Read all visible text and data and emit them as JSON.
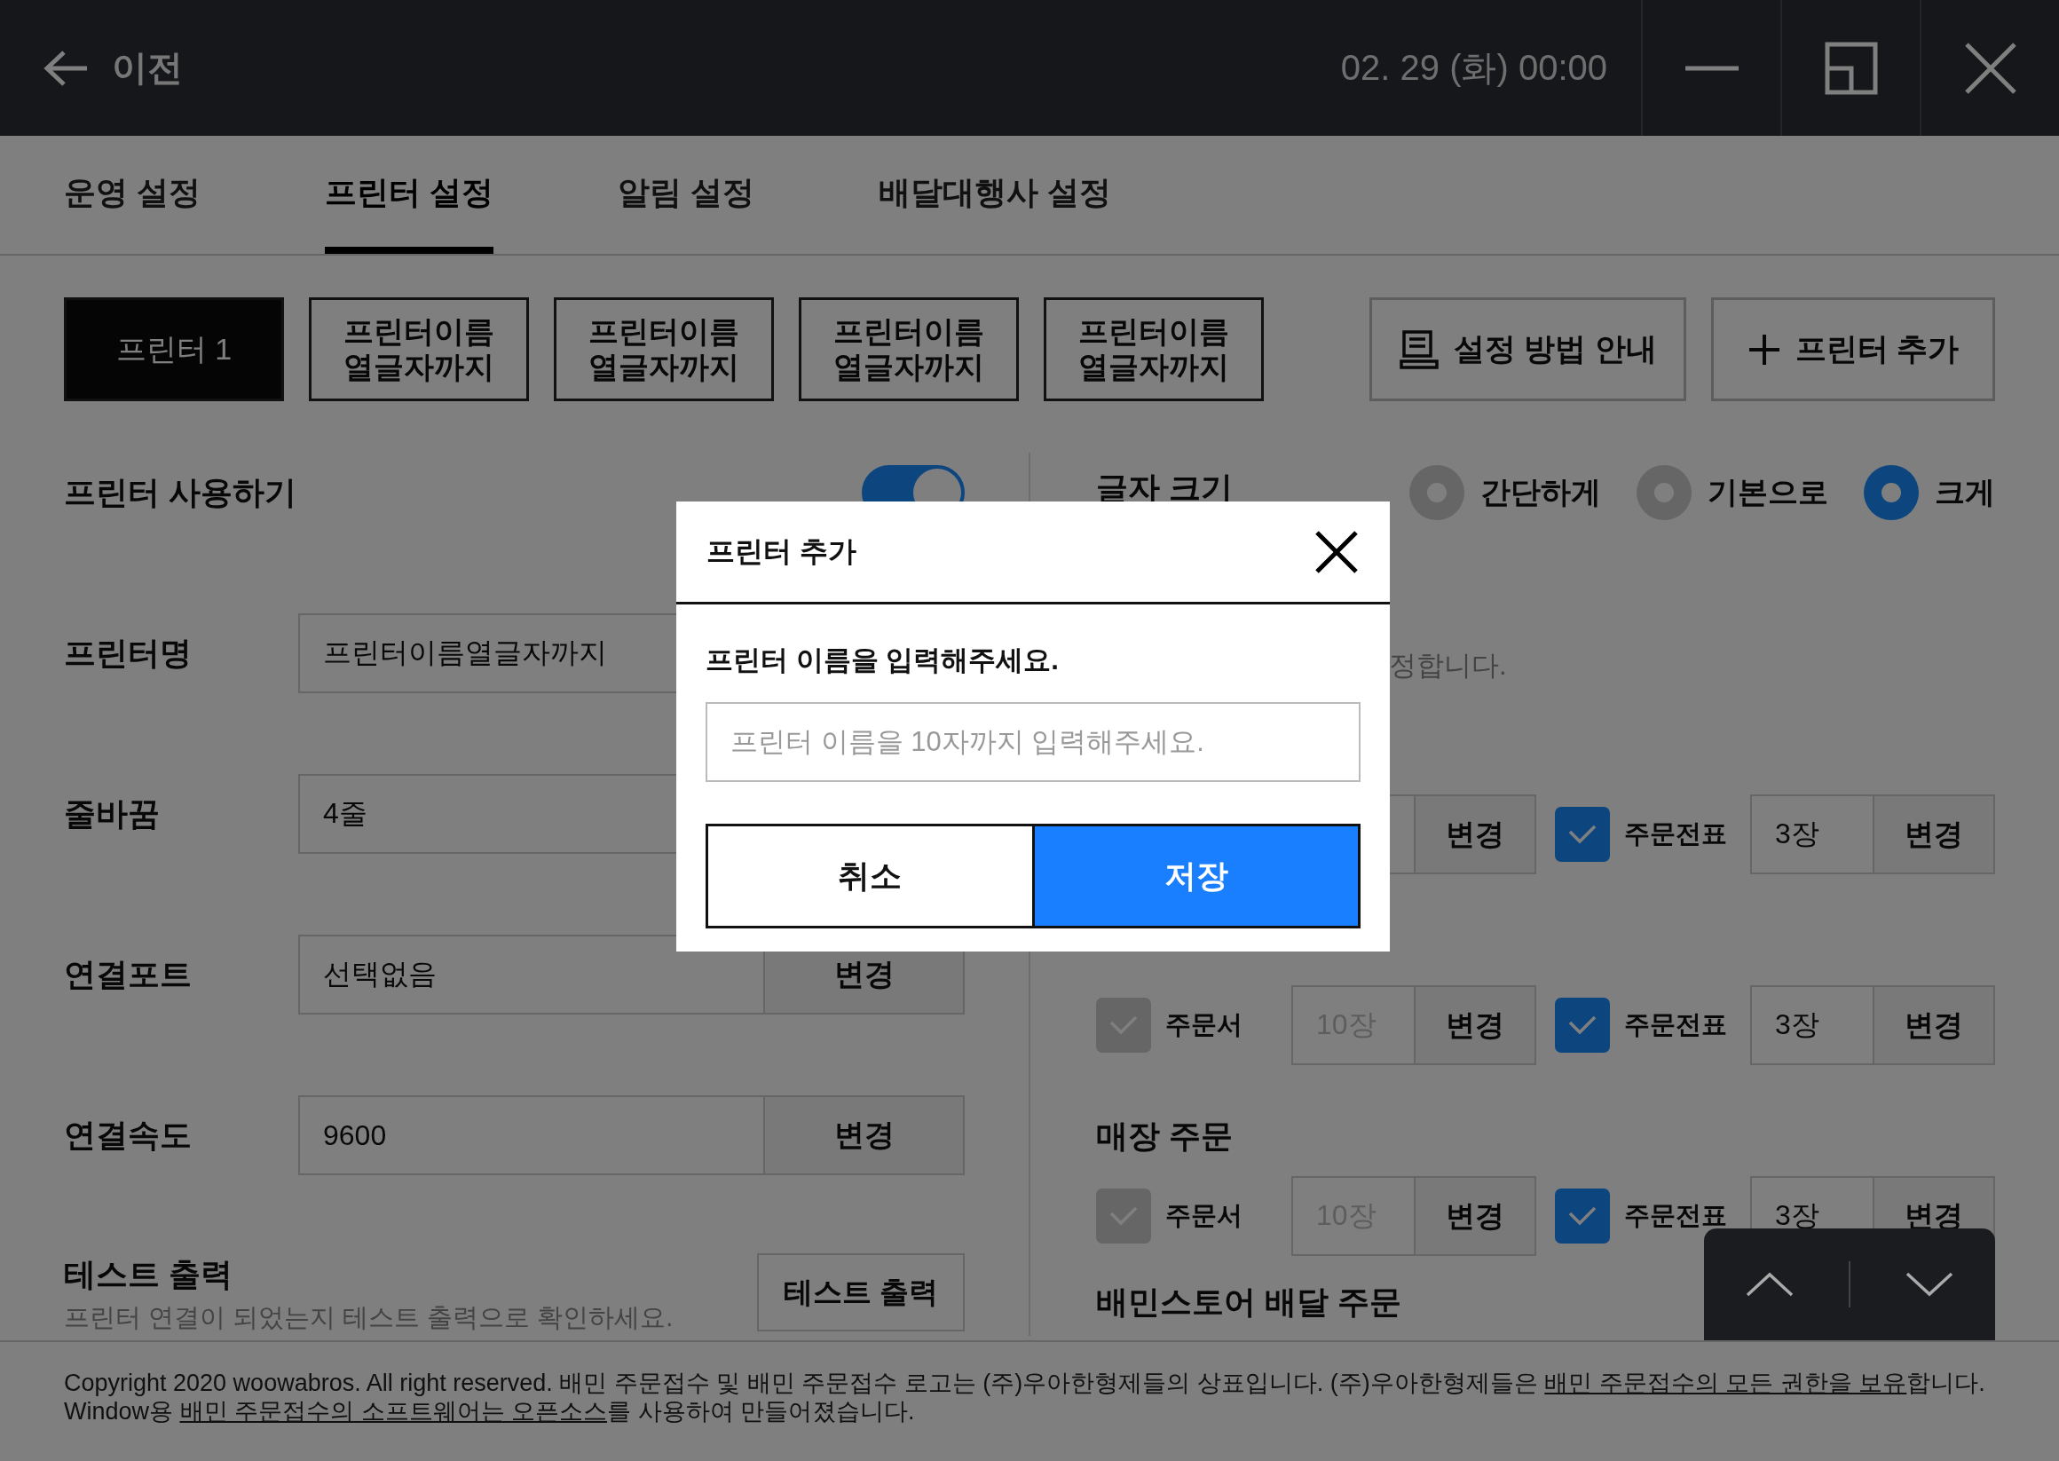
{
  "topbar": {
    "back_label": "이전",
    "datetime": "02. 29 (화) 00:00"
  },
  "tabs": [
    {
      "label": "운영 설정",
      "selected": false
    },
    {
      "label": "프린터 설정",
      "selected": true
    },
    {
      "label": "알림 설정",
      "selected": false
    },
    {
      "label": "배달대행사 설정",
      "selected": false
    }
  ],
  "printers": [
    {
      "label": "프린터 1",
      "selected": true
    },
    {
      "label": "프린터이름\n열글자까지",
      "selected": false
    },
    {
      "label": "프린터이름\n열글자까지",
      "selected": false
    },
    {
      "label": "프린터이름\n열글자까지",
      "selected": false
    },
    {
      "label": "프린터이름\n열글자까지",
      "selected": false
    }
  ],
  "actions": [
    {
      "kind": "guide",
      "label": "설정 방법 안내"
    },
    {
      "kind": "add",
      "label": "프린터 추가"
    }
  ],
  "use_printer": {
    "label": "프린터 사용하기",
    "on": true
  },
  "fields": [
    {
      "label": "프린터명",
      "value": "프린터이름열글자까지"
    },
    {
      "label": "줄바꿈",
      "value": "4줄"
    },
    {
      "label": "연결포트",
      "value": "선택없음",
      "button": "변경"
    },
    {
      "label": "연결속도",
      "value": "9600",
      "button": "변경"
    }
  ],
  "test_print": {
    "title": "테스트 출력",
    "description": "프린터 연결이 되었는지 테스트 출력으로 확인하세요.",
    "button": "테스트 출력"
  },
  "font_size": {
    "label": "글자 크기",
    "options": [
      {
        "label": "간단하게",
        "selected": false
      },
      {
        "label": "기본으로",
        "selected": false
      },
      {
        "label": "크게",
        "selected": true
      }
    ]
  },
  "font_size_note": "정합니다.",
  "order_items": [
    {
      "kind": "row",
      "groups": [
        {
          "button": "변경"
        },
        {
          "checked": true,
          "label": "주문전표",
          "count": "3장",
          "button": "변경"
        }
      ]
    },
    {
      "kind": "row",
      "groups": [
        {
          "checked": false,
          "label": "주문서",
          "count": "10장",
          "button": "변경"
        },
        {
          "checked": true,
          "label": "주문전표",
          "count": "3장",
          "button": "변경"
        }
      ]
    },
    {
      "kind": "heading",
      "title": "매장 주문"
    },
    {
      "kind": "row",
      "groups": [
        {
          "checked": false,
          "label": "주문서",
          "count": "10장",
          "button": "변경"
        },
        {
          "checked": true,
          "label": "주문전표",
          "count": "3장",
          "button": "변경"
        }
      ]
    },
    {
      "kind": "heading",
      "title": "배민스토어 배달 주문"
    }
  ],
  "footer": [
    [
      {
        "text": "Copyright 2020 woowabros. All right reserved. 배민 주문접수 및 배민 주문접수 로고는 (주)우아한형제들의 상표입니다. (주)우아한형제들은 ",
        "link": false
      },
      {
        "text": "배민 주문접수의 모든 권한을 보유",
        "link": true
      },
      {
        "text": "합니다.",
        "link": false
      }
    ],
    [
      {
        "text": "Window용 ",
        "link": false
      },
      {
        "text": "배민 주문접수의 소프트웨어는 오픈소스",
        "link": true
      },
      {
        "text": "를 사용하여 만들어졌습니다.",
        "link": false
      }
    ]
  ],
  "modal": {
    "title": "프린터 추가",
    "message": "프린터 이름을 입력해주세요.",
    "placeholder": "프린터 이름을 10자까지 입력해주세요.",
    "buttons": [
      {
        "kind": "cancel",
        "label": "취소"
      },
      {
        "kind": "primary",
        "label": "저장"
      }
    ]
  }
}
